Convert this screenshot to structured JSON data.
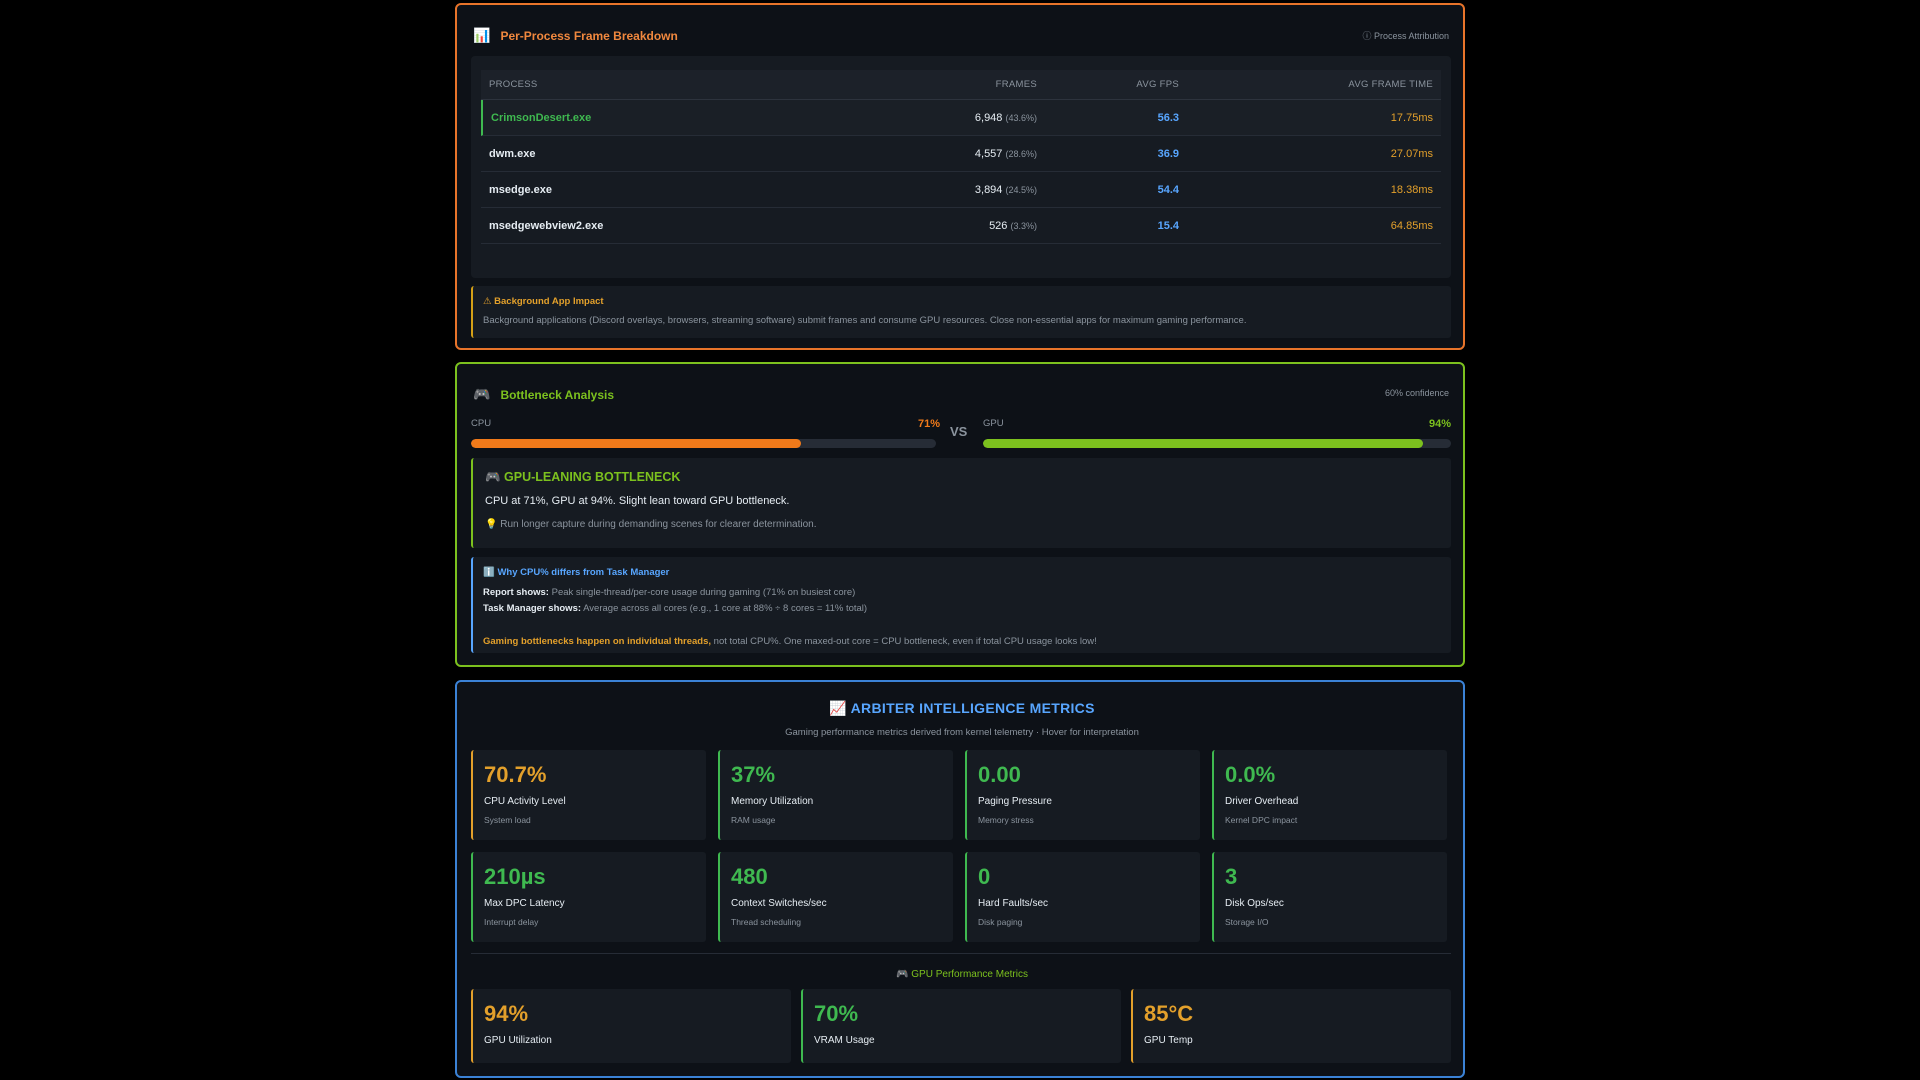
{
  "per_process": {
    "icon": "bar-chart-icon",
    "title": "Per-Process Frame Breakdown",
    "attribution": "ⓘ Process Attribution",
    "columns": [
      "PROCESS",
      "FRAMES",
      "AVG FPS",
      "AVG FRAME TIME"
    ],
    "rows": [
      {
        "process": "CrimsonDesert.exe",
        "frames": "6,948",
        "pct": "(43.6%)",
        "fps": "56.3",
        "frame_time": "17.75ms"
      },
      {
        "process": "dwm.exe",
        "frames": "4,557",
        "pct": "(28.6%)",
        "fps": "36.9",
        "frame_time": "27.07ms"
      },
      {
        "process": "msedge.exe",
        "frames": "3,894",
        "pct": "(24.5%)",
        "fps": "54.4",
        "frame_time": "18.38ms"
      },
      {
        "process": "msedgewebview2.exe",
        "frames": "526",
        "pct": "(3.3%)",
        "fps": "15.4",
        "frame_time": "64.85ms"
      }
    ],
    "warning_title": "⚠ Background App Impact",
    "warning_text": "Background applications (Discord overlays, browsers, streaming software) submit frames and consume GPU resources. Close non-essential apps for maximum gaming performance."
  },
  "bottleneck": {
    "icon": "gamepad-icon",
    "title": "Bottleneck Analysis",
    "confidence": "60% confidence",
    "cpu_label": "CPU",
    "cpu_pct": "71%",
    "cpu_value": 0.71,
    "vs": "VS",
    "gpu_label": "GPU",
    "gpu_pct": "94%",
    "gpu_value": 0.94,
    "verdict_title": "🎮 GPU-LEANING BOTTLENECK",
    "verdict_text": "CPU at 71%, GPU at 94%. Slight lean toward GPU bottleneck.",
    "tip": "💡 Run longer capture during demanding scenes for clearer determination.",
    "info_title": "ℹ️ Why CPU% differs from Task Manager",
    "report_label": "Report shows:",
    "report_text": " Peak single-thread/per-core usage during gaming (71% on busiest core)",
    "tm_label": "Task Manager shows:",
    "tm_text": " Average across all cores (e.g., 1 core at 88% ÷ 8 cores = 11% total)",
    "note_em": "Gaming bottlenecks happen on individual threads,",
    "note_text": " not total CPU%. One maxed-out core = CPU bottleneck, even if total CPU usage looks low!"
  },
  "metrics": {
    "title": "📈 ARBITER INTELLIGENCE METRICS",
    "subtitle": "Gaming performance metrics derived from kernel telemetry · Hover for interpretation",
    "cards": [
      {
        "value": "70.7%",
        "name": "CPU Activity Level",
        "sub": "System load",
        "color": "#e3a02b"
      },
      {
        "value": "37%",
        "name": "Memory Utilization",
        "sub": "RAM usage",
        "color": "#3fb950"
      },
      {
        "value": "0.00",
        "name": "Paging Pressure",
        "sub": "Memory stress",
        "color": "#3fb950"
      },
      {
        "value": "0.0%",
        "name": "Driver Overhead",
        "sub": "Kernel DPC impact",
        "color": "#3fb950"
      },
      {
        "value": "210µs",
        "name": "Max DPC Latency",
        "sub": "Interrupt delay",
        "color": "#3fb950"
      },
      {
        "value": "480",
        "name": "Context Switches/sec",
        "sub": "Thread scheduling",
        "color": "#3fb950"
      },
      {
        "value": "0",
        "name": "Hard Faults/sec",
        "sub": "Disk paging",
        "color": "#3fb950"
      },
      {
        "value": "3",
        "name": "Disk Ops/sec",
        "sub": "Storage I/O",
        "color": "#3fb950"
      }
    ],
    "gpu_title": "🎮 GPU Performance Metrics",
    "gpu_cards": [
      {
        "value": "94%",
        "name": "GPU Utilization",
        "color": "#e3a02b"
      },
      {
        "value": "70%",
        "name": "VRAM Usage",
        "color": "#3fb950"
      },
      {
        "value": "85°C",
        "name": "GPU Temp",
        "color": "#e3a02b"
      }
    ]
  },
  "colors": {
    "orange_border": "#e8742a",
    "green_border": "#7cc11e",
    "blue_border": "#3b82d6",
    "cpu_bar": "#f07a1a",
    "gpu_bar": "#7cc11e"
  }
}
